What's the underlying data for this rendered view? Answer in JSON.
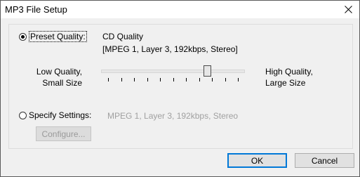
{
  "window": {
    "title": "MP3 File Setup",
    "close_glyph": "✕"
  },
  "preset": {
    "label": "Preset Quality:",
    "quality_name": "CD Quality",
    "quality_detail": "[MPEG 1, Layer 3, 192kbps, Stereo]",
    "low_line1": "Low Quality,",
    "low_line2": "Small Size",
    "high_line1": "High Quality,",
    "high_line2": "Large Size",
    "slider_value_fraction": 0.76
  },
  "specify": {
    "label": "Specify Settings:",
    "value": "MPEG 1, Layer 3, 192kbps, Stereo",
    "configure_label": "Configure..."
  },
  "buttons": {
    "ok": "OK",
    "cancel": "Cancel"
  },
  "colors": {
    "accent": "#0078d7"
  },
  "icons": [
    "close-icon"
  ]
}
